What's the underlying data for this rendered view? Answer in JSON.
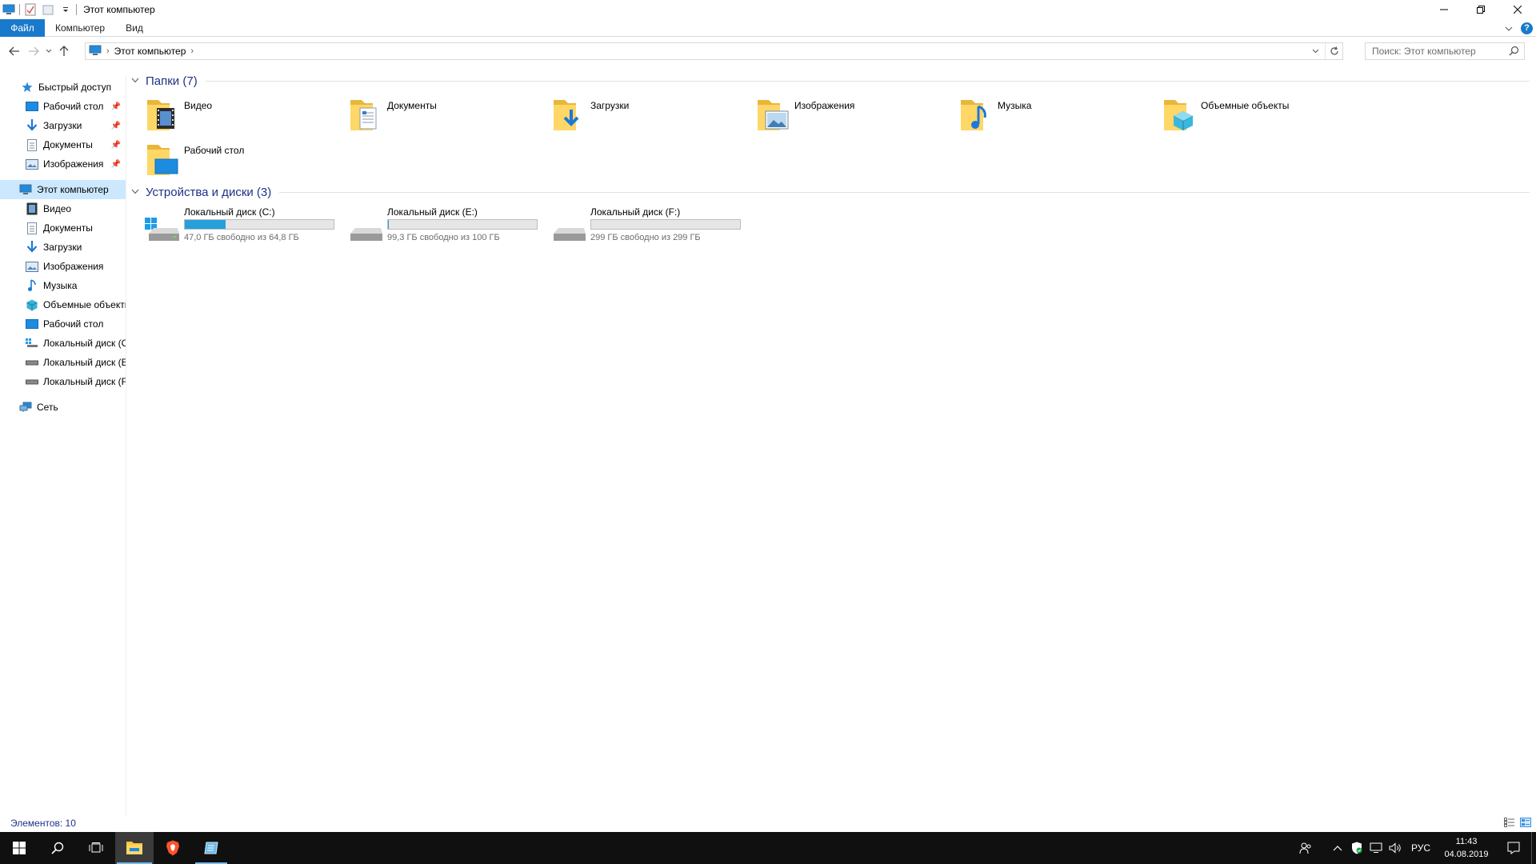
{
  "window": {
    "title": "Этот компьютер"
  },
  "ribbon": {
    "tabs": [
      {
        "label": "Файл"
      },
      {
        "label": "Компьютер"
      },
      {
        "label": "Вид"
      }
    ]
  },
  "navigation": {
    "breadcrumb": "Этот компьютер",
    "search_placeholder": "Поиск: Этот компьютер"
  },
  "sidebar": {
    "quick_access": {
      "label": "Быстрый доступ",
      "items": [
        {
          "label": "Рабочий стол",
          "icon": "desktop-icon"
        },
        {
          "label": "Загрузки",
          "icon": "downloads-icon"
        },
        {
          "label": "Документы",
          "icon": "documents-icon"
        },
        {
          "label": "Изображения",
          "icon": "pictures-icon"
        }
      ]
    },
    "this_pc": {
      "label": "Этот компьютер",
      "items": [
        {
          "label": "Видео",
          "icon": "videos-icon"
        },
        {
          "label": "Документы",
          "icon": "documents-icon"
        },
        {
          "label": "Загрузки",
          "icon": "downloads-icon"
        },
        {
          "label": "Изображения",
          "icon": "pictures-icon"
        },
        {
          "label": "Музыка",
          "icon": "music-icon"
        },
        {
          "label": "Объемные объекты",
          "icon": "3d-objects-icon"
        },
        {
          "label": "Рабочий стол",
          "icon": "desktop-icon"
        },
        {
          "label": "Локальный диск (C:)",
          "icon": "windows-drive-icon"
        },
        {
          "label": "Локальный диск (E:)",
          "icon": "drive-icon"
        },
        {
          "label": "Локальный диск (F:)",
          "icon": "drive-icon"
        }
      ]
    },
    "network": {
      "label": "Сеть"
    }
  },
  "content": {
    "folders_header": "Папки (7)",
    "folders": [
      {
        "label": "Видео",
        "icon": "videos-folder-icon"
      },
      {
        "label": "Документы",
        "icon": "documents-folder-icon"
      },
      {
        "label": "Загрузки",
        "icon": "downloads-folder-icon"
      },
      {
        "label": "Изображения",
        "icon": "pictures-folder-icon"
      },
      {
        "label": "Музыка",
        "icon": "music-folder-icon"
      },
      {
        "label": "Объемные объекты",
        "icon": "3d-objects-folder-icon"
      },
      {
        "label": "Рабочий стол",
        "icon": "desktop-folder-icon"
      }
    ],
    "drives_header": "Устройства и диски (3)",
    "drives": [
      {
        "label": "Локальный диск (C:)",
        "free_text": "47,0 ГБ свободно из 64,8 ГБ",
        "used_fraction": 0.275,
        "icon": "windows-drive-icon"
      },
      {
        "label": "Локальный диск (E:)",
        "free_text": "99,3 ГБ свободно из 100 ГБ",
        "used_fraction": 0.007,
        "icon": "drive-icon"
      },
      {
        "label": "Локальный диск (F:)",
        "free_text": "299 ГБ свободно из 299 ГБ",
        "used_fraction": 0.0,
        "icon": "drive-icon"
      }
    ]
  },
  "status": {
    "items_text": "Элементов: 10"
  },
  "taskbar": {
    "language": "РУС",
    "time": "11:43",
    "date": "04.08.2019"
  },
  "colors": {
    "accent": "#1979ca",
    "selection": "#cce8ff",
    "group_title": "#1e3287",
    "drive_bar": "#26a0da",
    "folder_yellow": "#ffd767"
  }
}
